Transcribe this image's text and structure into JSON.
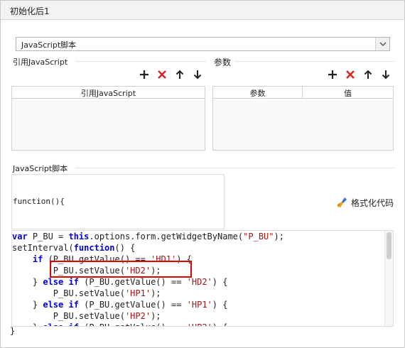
{
  "window": {
    "title": "初始化后1"
  },
  "script_type": {
    "selected": "JavaScript脚本"
  },
  "ref_js": {
    "section_label": "引用JavaScript",
    "column_header": "引用JavaScript"
  },
  "params": {
    "section_label": "参数",
    "columns": [
      "参数",
      "值"
    ]
  },
  "toolbar_icons": [
    "plus-icon",
    "delete-icon",
    "arrow-up-icon",
    "arrow-down-icon"
  ],
  "script": {
    "section_label": "JavaScript脚本",
    "function_header": "function(){",
    "format_button": "格式化代码",
    "closing": "}",
    "code_lines": [
      "var P_BU = this.options.form.getWidgetByName(\"P_BU\");",
      "setInterval(function() {",
      "    if (P_BU.getValue() == 'HD1') {",
      "        P_BU.setValue('HD2');",
      "    } else if (P_BU.getValue() == 'HD2') {",
      "        P_BU.setValue('HP1');",
      "    } else if (P_BU.getValue() == 'HP1') {",
      "        P_BU.setValue('HP2');",
      "    } else if (P_BU.getValue() == 'HP2') {"
    ]
  },
  "colors": {
    "keyword": "#0000e6",
    "string": "#a31515",
    "delete": "#e02020",
    "highlight": "#e00000"
  }
}
